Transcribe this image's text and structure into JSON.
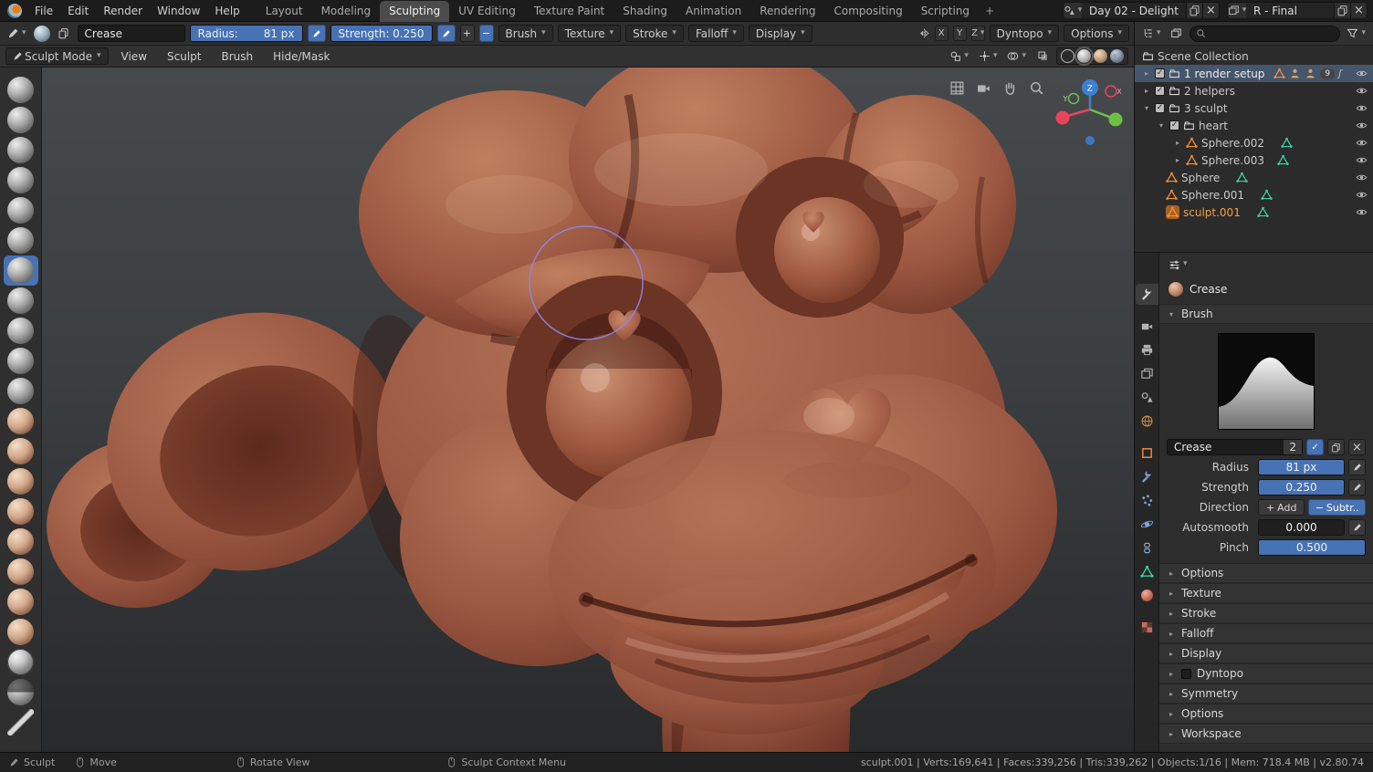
{
  "topbar": {
    "menus": [
      "File",
      "Edit",
      "Render",
      "Window",
      "Help"
    ],
    "tabs": [
      "Layout",
      "Modeling",
      "Sculpting",
      "UV Editing",
      "Texture Paint",
      "Shading",
      "Animation",
      "Rendering",
      "Compositing",
      "Scripting"
    ],
    "add_tab": "+",
    "scene": {
      "name": "Day 02 - Delight"
    },
    "view_layer": {
      "name": "R - Final"
    }
  },
  "tool_settings": {
    "radius_label": "Radius:",
    "strength_label": "Strength:",
    "popovers": {
      "brush": "Brush",
      "texture": "Texture",
      "stroke": "Stroke",
      "falloff": "Falloff",
      "display": "Display"
    },
    "mirror": {
      "x": "X",
      "y": "Y",
      "z": "Z"
    },
    "dyntopo": "Dyntopo",
    "options": "Options"
  },
  "brush": {
    "name": "Crease",
    "radius": "81 px",
    "strength": "0.250",
    "autosmooth": "0.000",
    "pinch": "0.500",
    "users": "2",
    "direction_add": "Add",
    "direction_subtract": "Subtr.."
  },
  "viewport_header": {
    "mode": "Sculpt Mode",
    "menus": [
      "View",
      "Sculpt",
      "Brush",
      "Hide/Mask"
    ]
  },
  "viewport": {
    "gizmo": {
      "x": "X",
      "y": "Y",
      "z": "Z"
    }
  },
  "toolbar_brushes": [
    "Draw",
    "Clay",
    "Clay Strips",
    "Layer",
    "Inflate",
    "Blob",
    "Crease",
    "Smooth",
    "Flatten",
    "Fill",
    "Scrape",
    "Pinch",
    "Grab",
    "Elastic Deform",
    "Snake Hook",
    "Thumb",
    "Pose",
    "Nudge",
    "Rotate",
    "Slide Relax",
    "Mask",
    "Annotate"
  ],
  "outliner": {
    "collection_title": "Scene Collection",
    "rows": [
      {
        "label": "Scene Collection"
      },
      {
        "label": "1 render setup",
        "count": "9"
      },
      {
        "label": "2 helpers"
      },
      {
        "label": "3 sculpt"
      },
      {
        "label": "heart"
      },
      {
        "label": "Sphere.002"
      },
      {
        "label": "Sphere.003"
      },
      {
        "label": "Sphere"
      },
      {
        "label": "Sphere.001"
      },
      {
        "label": "sculpt.001"
      }
    ]
  },
  "properties": {
    "active_tool_title": "Crease",
    "brush_section": "Brush",
    "labels": {
      "radius": "Radius",
      "strength": "Strength",
      "direction": "Direction",
      "autosmooth": "Autosmooth",
      "pinch": "Pinch"
    },
    "sections": [
      "Options",
      "Texture",
      "Stroke",
      "Falloff",
      "Display",
      "Dyntopo",
      "Symmetry",
      "Options",
      "Workspace"
    ]
  },
  "statusbar": {
    "hints": [
      {
        "label": "Sculpt"
      },
      {
        "label": "Move"
      },
      {
        "label": "Rotate View"
      },
      {
        "label": "Sculpt Context Menu"
      }
    ],
    "stats": "sculpt.001 | Verts:169,641 | Faces:339,256 | Tris:339,262 | Objects:1/16 | Mem: 718.4 MB | v2.80.74"
  },
  "colors": {
    "accent": "#4772b3",
    "object_orange": "#f0913c",
    "mesh_data_green": "#3fd0a4",
    "axis_x": "#e8455b",
    "axis_y": "#6fbf45",
    "axis_z": "#3f7fd0"
  }
}
